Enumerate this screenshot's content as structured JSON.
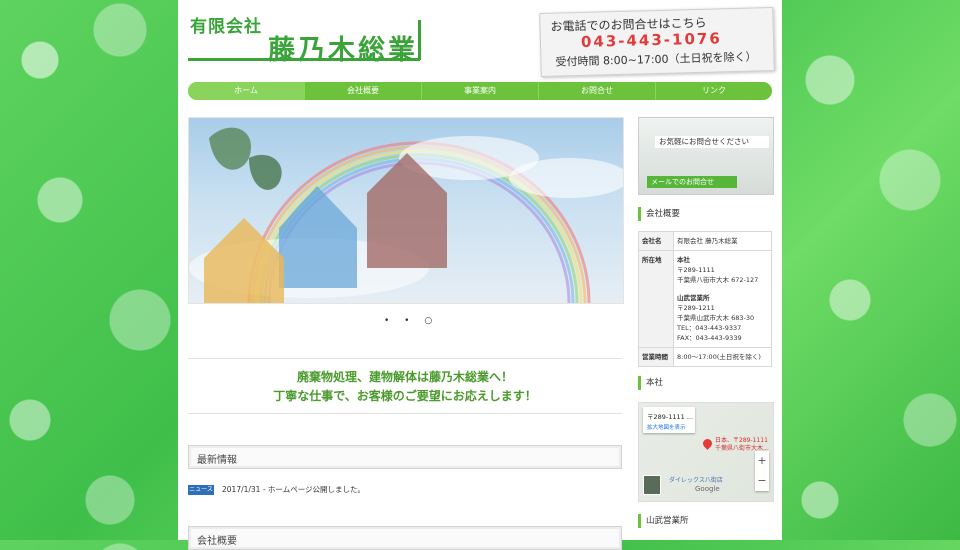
{
  "header": {
    "logo_small": "有限会社",
    "logo_big": "藤乃木総業",
    "phone_line1": "お電話でのお問合せはこちら",
    "phone_number": "043-443-1076",
    "phone_hours": "受付時間 8:00~17:00（土日祝を除く）"
  },
  "nav": {
    "items": [
      {
        "label": "ホーム",
        "active": true
      },
      {
        "label": "会社概要",
        "active": false
      },
      {
        "label": "事業案内",
        "active": false
      },
      {
        "label": "お問合せ",
        "active": false
      },
      {
        "label": "リンク",
        "active": false
      }
    ]
  },
  "slider": {
    "dots": "• • ○"
  },
  "catch": {
    "line1": "廃棄物処理、建物解体は藤乃木総業へ！",
    "line2": "丁寧な仕事で、お客様のご要望にお応えします！"
  },
  "news": {
    "title": "最新情報",
    "badge": "ニュース",
    "text": "2017/1/31 - ホームページ公開しました。"
  },
  "company_section": {
    "title": "会社概要"
  },
  "sidebar": {
    "banner_caption": "お気軽にお問合せください",
    "banner_mail": "メールでのお問合せ",
    "company_title": "会社概要",
    "table": {
      "company_key": "会社名",
      "company_val": "有限会社 藤乃木総業",
      "address_key": "所在地",
      "hq_label": "本社",
      "hq_zip": "〒289-1111",
      "hq_addr": "千葉県八街市大木 672-127",
      "branch_label": "山武営業所",
      "branch_zip": "〒289-1211",
      "branch_addr": "千葉県山武市大木 683-30",
      "tel": "TEL：043-443-9337",
      "fax": "FAX：043-443-9339",
      "hours_key": "営業時間",
      "hours_val": "8:00～17:00(土日祝を除く)"
    },
    "hq_title": "本社",
    "map": {
      "addr": "〒289-1111 ...",
      "enlarge": "拡大地図を表示",
      "pin_label": "日本、〒289-1111\n千葉県八街市大木...",
      "place": "ダイレックス八街店",
      "google": "Google"
    },
    "branch_title": "山武営業所"
  },
  "colors": {
    "brand_green": "#3aa33a",
    "nav_green": "#6cc23a",
    "phone_red": "#e03a3a",
    "badge_blue": "#2f6fb8"
  }
}
